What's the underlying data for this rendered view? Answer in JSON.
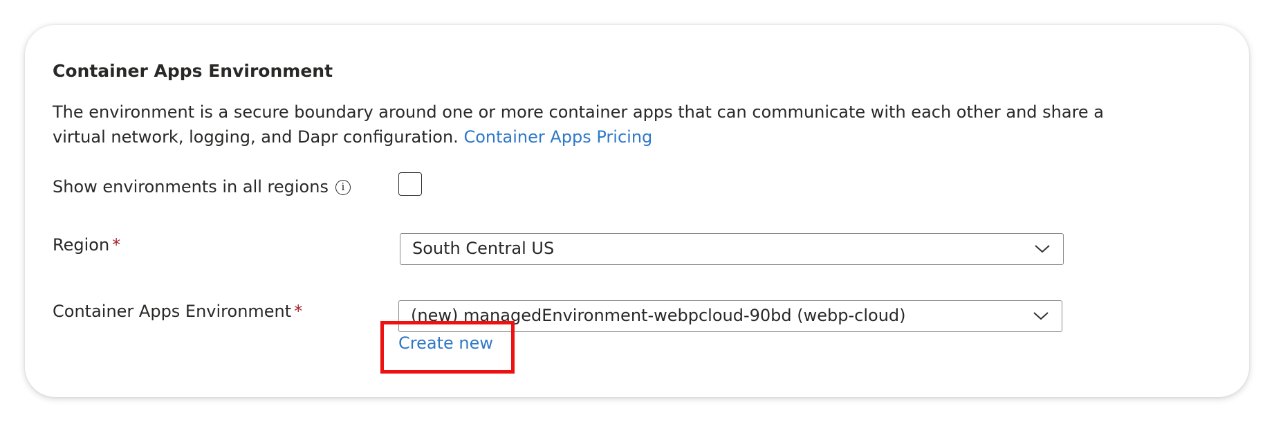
{
  "section": {
    "title": "Container Apps Environment",
    "description": "The environment is a secure boundary around one or more container apps that can communicate with each other and share a virtual network, logging, and Dapr configuration.",
    "pricing_link": "Container Apps Pricing"
  },
  "show_all_regions": {
    "label": "Show environments in all regions",
    "info_icon_glyph": "i",
    "checked": false
  },
  "region": {
    "label": "Region",
    "required_marker": "*",
    "value": "South Central US"
  },
  "environment": {
    "label": "Container Apps Environment",
    "required_marker": "*",
    "value": "(new) managedEnvironment-webpcloud-90bd (webp-cloud)",
    "create_new_label": "Create new"
  },
  "colors": {
    "link": "#2f78c8",
    "required": "#a4262c",
    "highlight": "#ee1111",
    "text": "#292827"
  },
  "icons": {
    "info": "info-icon",
    "dropdown": "chevron-down-icon"
  }
}
